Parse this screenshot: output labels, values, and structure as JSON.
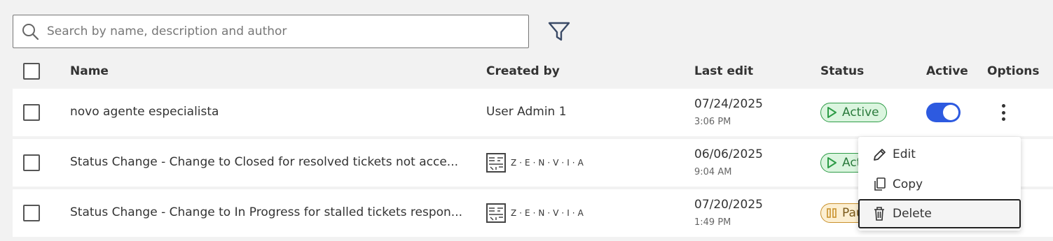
{
  "search": {
    "placeholder": "Search by name, description and author"
  },
  "table": {
    "headers": {
      "name": "Name",
      "created_by": "Created by",
      "last_edit": "Last edit",
      "status": "Status",
      "active": "Active",
      "options": "Options"
    },
    "rows": [
      {
        "name": "novo agente especialista",
        "created_by": "User Admin 1",
        "date": "07/24/2025",
        "time": "3:06 PM",
        "status": "Active",
        "active": true
      },
      {
        "name": "Status Change - Change to Closed for resolved tickets not acce...",
        "created_by": "Z·E·N·V·I·A",
        "date": "06/06/2025",
        "time": "9:04 AM",
        "status": "Active"
      },
      {
        "name": "Status Change - Change to In Progress for stalled tickets respon...",
        "created_by": "Z·E·N·V·I·A",
        "date": "07/20/2025",
        "time": "1:49 PM",
        "status": "Paused"
      }
    ]
  },
  "menu": {
    "edit": "Edit",
    "copy": "Copy",
    "delete": "Delete"
  },
  "colors": {
    "accent": "#2d5ae0",
    "active_badge": "#dbf5df",
    "paused_badge": "#fcefd2"
  }
}
